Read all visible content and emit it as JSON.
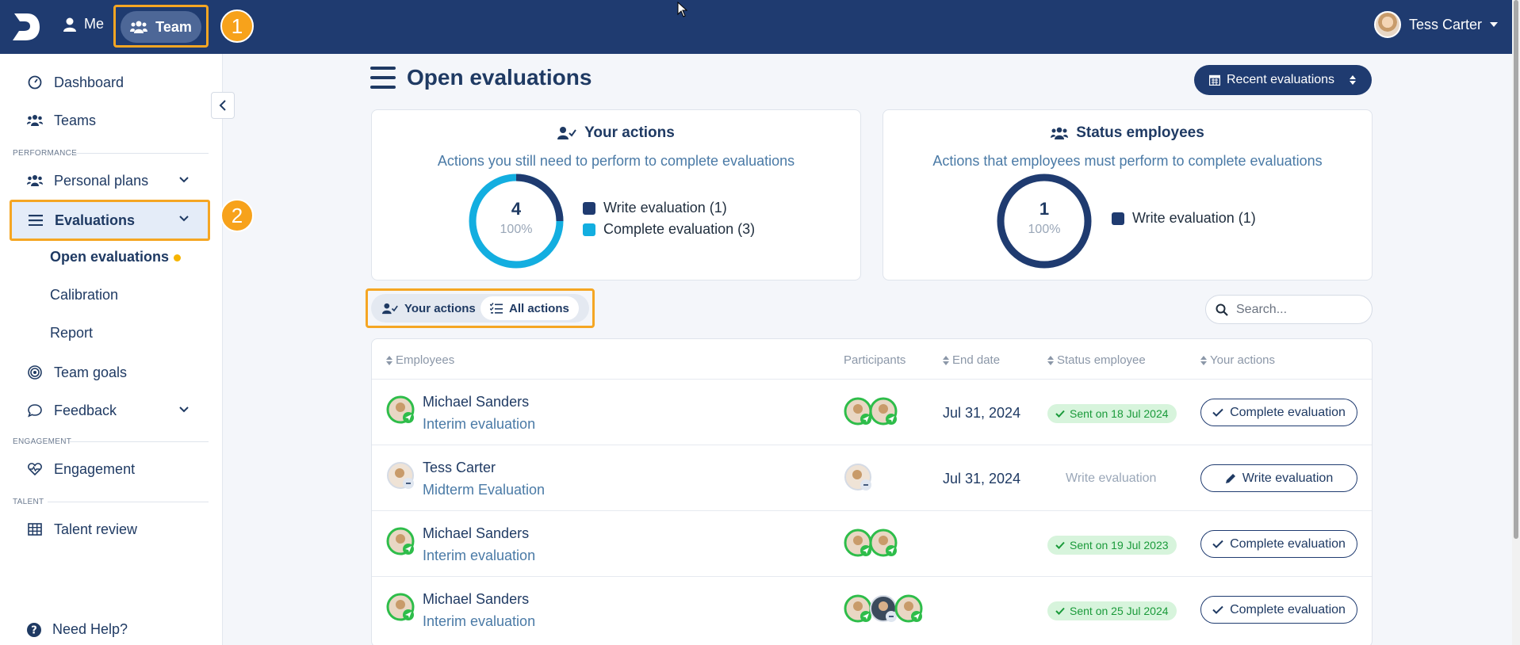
{
  "header": {
    "me_label": "Me",
    "team_label": "Team",
    "user_name": "Tess Carter",
    "badge_1": "1",
    "badge_2": "2"
  },
  "sidebar": {
    "dashboard": "Dashboard",
    "teams": "Teams",
    "section_performance": "PERFORMANCE",
    "personal_plans": "Personal plans",
    "evaluations": "Evaluations",
    "open_evaluations": "Open evaluations",
    "calibration": "Calibration",
    "report": "Report",
    "team_goals": "Team goals",
    "feedback": "Feedback",
    "section_engagement": "ENGAGEMENT",
    "engagement": "Engagement",
    "section_talent": "TALENT",
    "talent_review": "Talent review",
    "need_help": "Need Help?"
  },
  "main": {
    "title": "Open evaluations",
    "recent_button": "Recent evaluations",
    "your_actions_card": {
      "title": "Your actions",
      "subtitle": "Actions you still need to perform to complete evaluations",
      "total": "4",
      "percent": "100%",
      "legend": [
        {
          "label": "Write evaluation (1)",
          "color": "#1f3b70"
        },
        {
          "label": "Complete evaluation (3)",
          "color": "#13aee0"
        }
      ]
    },
    "status_card": {
      "title": "Status employees",
      "subtitle": "Actions that employees must perform to complete evaluations",
      "total": "1",
      "percent": "100%",
      "legend": [
        {
          "label": "Write evaluation (1)",
          "color": "#1f3b70"
        }
      ]
    },
    "toggle": {
      "your_actions": "Your actions",
      "all_actions": "All actions"
    },
    "search_placeholder": "Search...",
    "table": {
      "headers": [
        "Employees",
        "Participants",
        "End date",
        "Status employee",
        "Your actions"
      ],
      "rows": [
        {
          "name": "Michael Sanders",
          "type": "Interim evaluation",
          "end_date": "Jul 31, 2024",
          "status": "Sent on 18 Jul 2024",
          "action": "Complete evaluation"
        },
        {
          "name": "Tess Carter",
          "type": "Midterm Evaluation",
          "end_date": "Jul 31, 2024",
          "status": "Write evaluation",
          "action": "Write evaluation"
        },
        {
          "name": "Michael Sanders",
          "type": "Interim evaluation",
          "end_date": "",
          "status": "Sent on 19 Jul 2023",
          "action": "Complete evaluation"
        },
        {
          "name": "Michael Sanders",
          "type": "Interim evaluation",
          "end_date": "",
          "status": "Sent on 25 Jul 2024",
          "action": "Complete evaluation"
        }
      ]
    }
  },
  "colors": {
    "brand": "#1f3b70",
    "accent": "#13aee0",
    "highlight": "#f5a623",
    "success": "#1a9a3a"
  }
}
